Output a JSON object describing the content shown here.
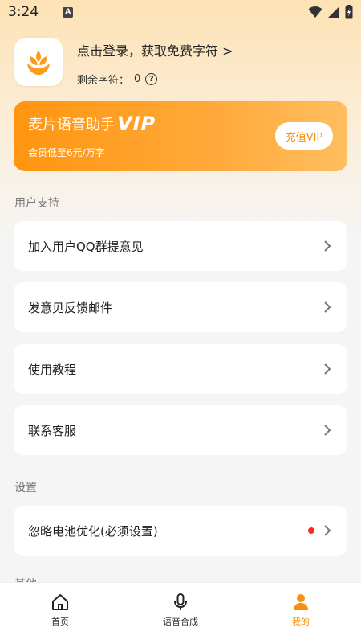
{
  "status_bar": {
    "time": "3:24",
    "notification_icon": "A"
  },
  "profile": {
    "login_text": "点击登录，获取免费字符 >",
    "remaining_label": "剩余字符：",
    "remaining_value": "0"
  },
  "vip_card": {
    "title": "麦片语音助手",
    "title_badge": "VIP",
    "subtitle": "会员低至6元/万字",
    "button_label": "充值VIP"
  },
  "sections": {
    "support_title": "用户支持",
    "support_items": [
      {
        "label": "加入用户QQ群提意见"
      },
      {
        "label": "发意见反馈邮件"
      },
      {
        "label": "使用教程"
      },
      {
        "label": "联系客服"
      }
    ],
    "settings_title": "设置",
    "settings_items": [
      {
        "label": "忽略电池优化(必须设置)"
      }
    ],
    "other_title": "其他"
  },
  "tabbar": {
    "tabs": [
      {
        "label": "首页",
        "icon": "home-icon"
      },
      {
        "label": "语音合成",
        "icon": "microphone-icon"
      },
      {
        "label": "我的",
        "icon": "person-icon"
      }
    ],
    "active_index": 2
  },
  "colors": {
    "accent": "#f7900f",
    "red_dot": "#ff2a20"
  }
}
